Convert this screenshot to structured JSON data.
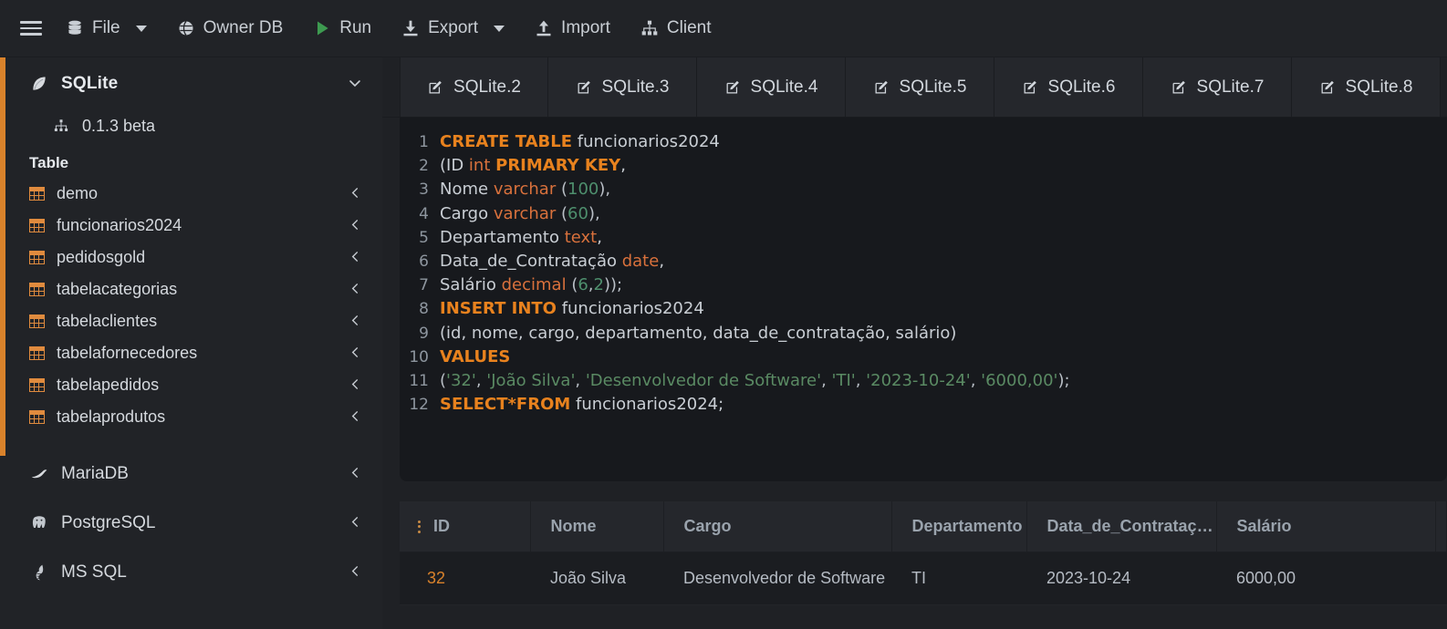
{
  "toolbar": {
    "menu_icon": "hamburger-icon",
    "items": [
      {
        "id": "file",
        "label": "File",
        "icon": "database-icon",
        "has_caret": true
      },
      {
        "id": "ownerdb",
        "label": "Owner DB",
        "icon": "globe-icon",
        "has_caret": false
      },
      {
        "id": "run",
        "label": "Run",
        "icon": "play-icon",
        "has_caret": false
      },
      {
        "id": "export",
        "label": "Export",
        "icon": "download-icon",
        "has_caret": true
      },
      {
        "id": "import",
        "label": "Import",
        "icon": "upload-icon",
        "has_caret": false
      },
      {
        "id": "client",
        "label": "Client",
        "icon": "sitemap-icon",
        "has_caret": false
      }
    ]
  },
  "sidebar": {
    "database": {
      "name": "SQLite",
      "icon": "sqlite-feather-icon",
      "expanded": true,
      "chevron": "⌄"
    },
    "version": {
      "label": "0.1.3 beta",
      "icon": "sitemap-icon"
    },
    "section_label": "Table",
    "tables": [
      {
        "name": "demo"
      },
      {
        "name": "funcionarios2024"
      },
      {
        "name": "pedidosgold"
      },
      {
        "name": "tabelacategorias"
      },
      {
        "name": "tabelaclientes"
      },
      {
        "name": "tabelafornecedores"
      },
      {
        "name": "tabelapedidos"
      },
      {
        "name": "tabelaprodutos"
      }
    ],
    "engines": [
      {
        "name": "MariaDB",
        "icon": "mariadb-seal-icon"
      },
      {
        "name": "PostgreSQL",
        "icon": "postgresql-elephant-icon"
      },
      {
        "name": "MS SQL",
        "icon": "mssql-icon"
      }
    ],
    "collapse_chevron": "‹",
    "accent_color": "#d9822b"
  },
  "tabs": [
    {
      "label": "SQLite.2",
      "icon": "edit-square-icon"
    },
    {
      "label": "SQLite.3",
      "icon": "edit-square-icon"
    },
    {
      "label": "SQLite.4",
      "icon": "edit-square-icon"
    },
    {
      "label": "SQLite.5",
      "icon": "edit-square-icon"
    },
    {
      "label": "SQLite.6",
      "icon": "edit-square-icon"
    },
    {
      "label": "SQLite.7",
      "icon": "edit-square-icon"
    },
    {
      "label": "SQLite.8",
      "icon": "edit-square-icon"
    }
  ],
  "editor": {
    "lines": [
      {
        "n": "1",
        "tokens": [
          {
            "t": "CREATE TABLE",
            "c": "kw"
          },
          {
            "t": " funcionarios2024",
            "c": "ccode"
          }
        ]
      },
      {
        "n": "2",
        "tokens": [
          {
            "t": "(ID ",
            "c": "ccode"
          },
          {
            "t": "int",
            "c": "typ"
          },
          {
            "t": " ",
            "c": "ccode"
          },
          {
            "t": "PRIMARY KEY",
            "c": "kw"
          },
          {
            "t": ",",
            "c": "ccode"
          }
        ]
      },
      {
        "n": "3",
        "tokens": [
          {
            "t": "Nome ",
            "c": "ccode"
          },
          {
            "t": "varchar",
            "c": "typ"
          },
          {
            "t": " (",
            "c": "pun"
          },
          {
            "t": "100",
            "c": "num"
          },
          {
            "t": "),",
            "c": "pun"
          }
        ]
      },
      {
        "n": "4",
        "tokens": [
          {
            "t": "Cargo ",
            "c": "ccode"
          },
          {
            "t": "varchar",
            "c": "typ"
          },
          {
            "t": " (",
            "c": "pun"
          },
          {
            "t": "60",
            "c": "num"
          },
          {
            "t": "),",
            "c": "pun"
          }
        ]
      },
      {
        "n": "5",
        "tokens": [
          {
            "t": "Departamento ",
            "c": "ccode"
          },
          {
            "t": "text",
            "c": "typ"
          },
          {
            "t": ",",
            "c": "ccode"
          }
        ]
      },
      {
        "n": "6",
        "tokens": [
          {
            "t": "Data_de_Contratação ",
            "c": "ccode"
          },
          {
            "t": "date",
            "c": "typ"
          },
          {
            "t": ",",
            "c": "ccode"
          }
        ]
      },
      {
        "n": "7",
        "tokens": [
          {
            "t": "Salário ",
            "c": "ccode"
          },
          {
            "t": "decimal",
            "c": "typ"
          },
          {
            "t": " (",
            "c": "pun"
          },
          {
            "t": "6",
            "c": "num"
          },
          {
            "t": ",",
            "c": "pun"
          },
          {
            "t": "2",
            "c": "num"
          },
          {
            "t": "));",
            "c": "pun"
          }
        ]
      },
      {
        "n": "8",
        "tokens": [
          {
            "t": "INSERT INTO",
            "c": "kw"
          },
          {
            "t": " funcionarios2024",
            "c": "ccode"
          }
        ]
      },
      {
        "n": "9",
        "tokens": [
          {
            "t": "(id, nome, cargo, departamento, data_de_contratação, salário)",
            "c": "ccode"
          }
        ]
      },
      {
        "n": "10",
        "tokens": [
          {
            "t": "VALUES",
            "c": "kw"
          }
        ]
      },
      {
        "n": "11",
        "tokens": [
          {
            "t": "(",
            "c": "pun"
          },
          {
            "t": "'32'",
            "c": "str"
          },
          {
            "t": ", ",
            "c": "pun"
          },
          {
            "t": "'João Silva'",
            "c": "str"
          },
          {
            "t": ", ",
            "c": "pun"
          },
          {
            "t": "'Desenvolvedor de Software'",
            "c": "str"
          },
          {
            "t": ", ",
            "c": "pun"
          },
          {
            "t": "'TI'",
            "c": "str"
          },
          {
            "t": ", ",
            "c": "pun"
          },
          {
            "t": "'2023-10-24'",
            "c": "str"
          },
          {
            "t": ", ",
            "c": "pun"
          },
          {
            "t": "'6000,00'",
            "c": "str"
          },
          {
            "t": ");",
            "c": "pun"
          }
        ]
      },
      {
        "n": "12",
        "tokens": [
          {
            "t": "SELECT*FROM",
            "c": "kw"
          },
          {
            "t": " funcionarios2024;",
            "c": "ccode"
          }
        ]
      }
    ]
  },
  "results": {
    "row_menu_icon": "vertical-dots-icon",
    "columns": [
      "ID",
      "Nome",
      "Cargo",
      "Departamento",
      "Data_de_Contratação",
      "Salário"
    ],
    "rows": [
      {
        "ID": "32",
        "Nome": "João Silva",
        "Cargo": "Desenvolvedor de Software",
        "Departamento": "TI",
        "Data_de_Contratação": "2023-10-24",
        "Salário": "6000,00"
      }
    ]
  }
}
